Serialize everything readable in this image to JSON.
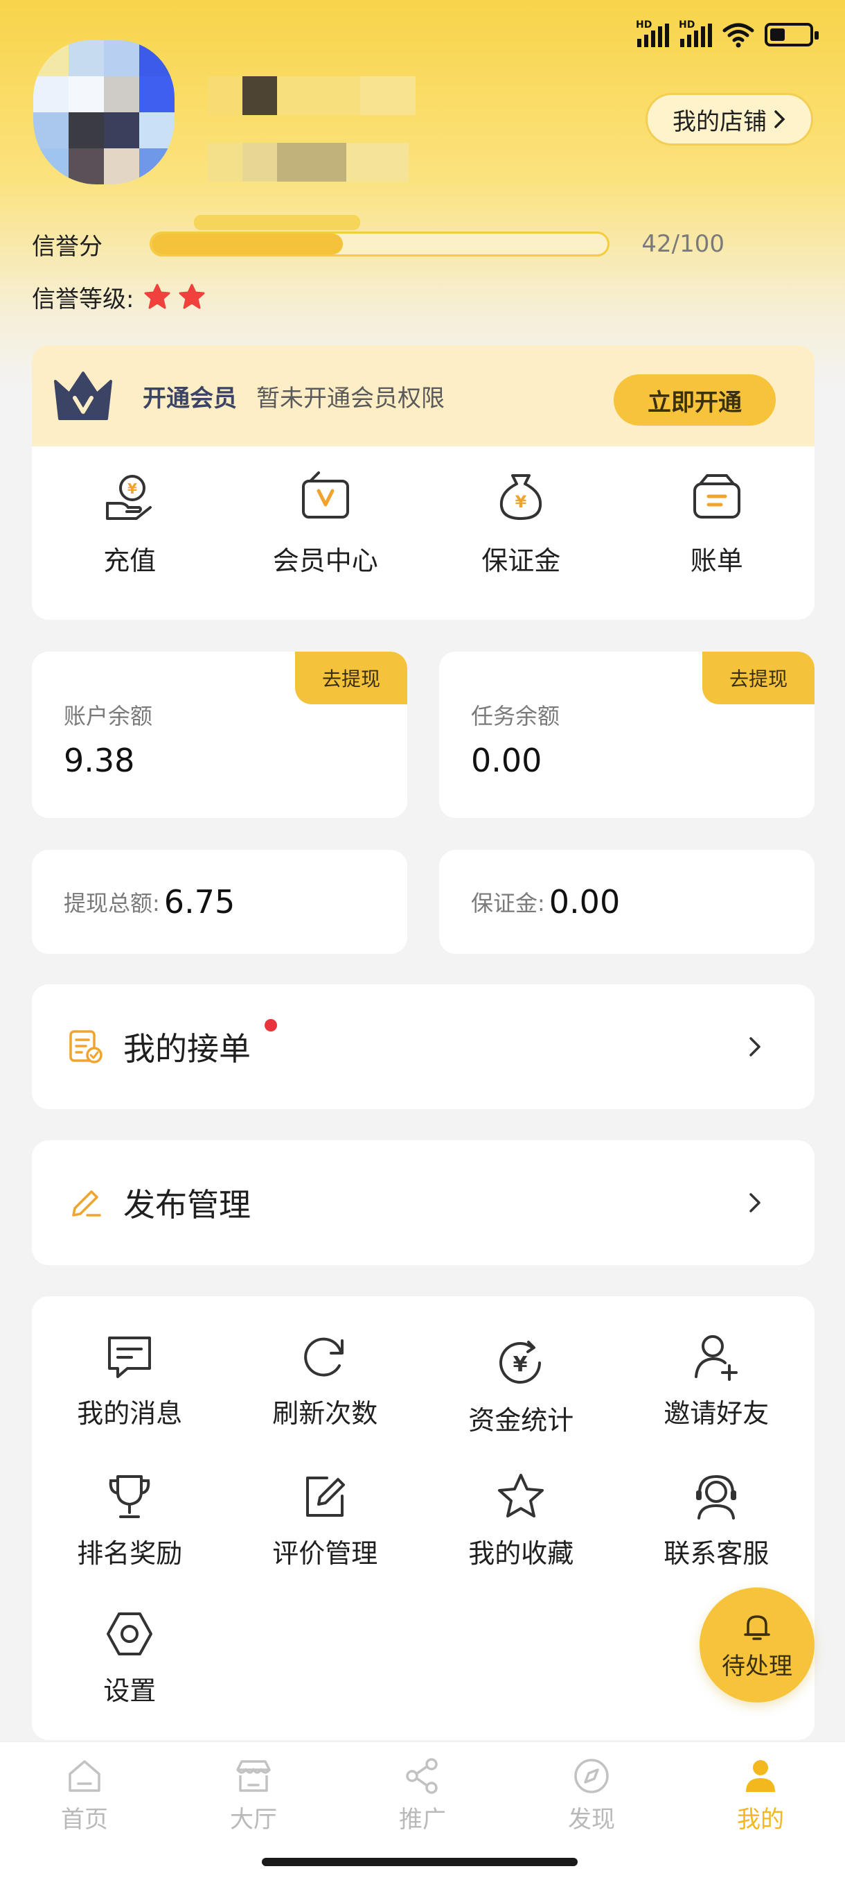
{
  "store_button": {
    "label": "我的店铺"
  },
  "credit": {
    "label": "信誉分",
    "value": 42,
    "max": 100,
    "display": "42/100"
  },
  "level": {
    "label": "信誉等级:",
    "stars": 2
  },
  "vip": {
    "title": "开通会员",
    "desc": "暂未开通会员权限",
    "button": "立即开通"
  },
  "quick_actions": [
    {
      "label": "充值",
      "icon": "recharge-icon"
    },
    {
      "label": "会员中心",
      "icon": "member-center-icon"
    },
    {
      "label": "保证金",
      "icon": "deposit-icon"
    },
    {
      "label": "账单",
      "icon": "bill-icon"
    }
  ],
  "balances": {
    "account": {
      "label": "账户余额",
      "value": "9.38",
      "action": "去提现"
    },
    "task": {
      "label": "任务余额",
      "value": "0.00",
      "action": "去提现"
    }
  },
  "stats": {
    "withdraw_total": {
      "label": "提现总额:",
      "value": "6.75"
    },
    "deposit": {
      "label": "保证金:",
      "value": "0.00"
    }
  },
  "menu": {
    "orders": {
      "label": "我的接单"
    },
    "publish": {
      "label": "发布管理"
    }
  },
  "tools": [
    {
      "label": "我的消息",
      "icon": "message-icon"
    },
    {
      "label": "刷新次数",
      "icon": "refresh-icon"
    },
    {
      "label": "资金统计",
      "icon": "fund-stats-icon"
    },
    {
      "label": "邀请好友",
      "icon": "invite-friend-icon"
    },
    {
      "label": "排名奖励",
      "icon": "trophy-icon"
    },
    {
      "label": "评价管理",
      "icon": "edit-review-icon"
    },
    {
      "label": "我的收藏",
      "icon": "star-icon"
    },
    {
      "label": "联系客服",
      "icon": "customer-service-icon"
    },
    {
      "label": "设置",
      "icon": "settings-icon"
    }
  ],
  "fab": {
    "label": "待处理"
  },
  "nav": [
    {
      "label": "首页",
      "icon": "home-icon",
      "active": false
    },
    {
      "label": "大厅",
      "icon": "hall-icon",
      "active": false
    },
    {
      "label": "推广",
      "icon": "share-icon",
      "active": false
    },
    {
      "label": "发现",
      "icon": "compass-icon",
      "active": false
    },
    {
      "label": "我的",
      "icon": "profile-icon",
      "active": true
    }
  ],
  "colors": {
    "accent": "#f5c33b",
    "accent_text": "#f2b81d",
    "vip_band": "#fdeec6",
    "dot": "#e9343b",
    "icon_orange": "#f0a42d"
  }
}
